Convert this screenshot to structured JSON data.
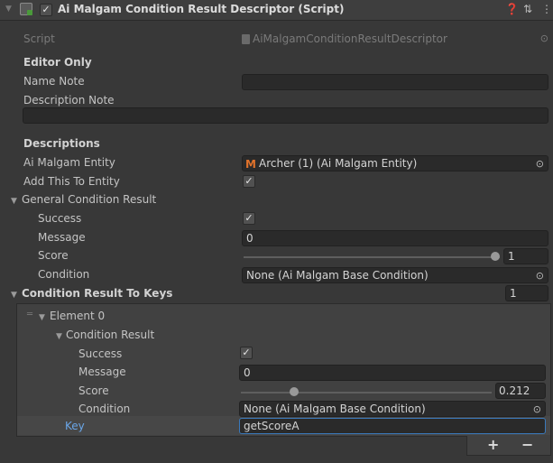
{
  "header": {
    "title": "Ai Malgam Condition Result Descriptor (Script)",
    "enabled_checked": true,
    "icons": [
      "fold-arrow-icon",
      "script-icon",
      "help-icon",
      "preset-icon",
      "kebab-menu-icon"
    ]
  },
  "script_row": {
    "label": "Script",
    "value": "AiMalgamConditionResultDescriptor"
  },
  "editor_only": {
    "heading": "Editor Only",
    "name_note_label": "Name Note",
    "name_note_value": "",
    "description_note_label": "Description Note",
    "description_note_value": ""
  },
  "descriptions": {
    "heading": "Descriptions",
    "entity_label": "Ai Malgam Entity",
    "entity_value": "Archer (1) (Ai Malgam Entity)",
    "add_to_entity_label": "Add This To Entity",
    "add_to_entity_checked": true
  },
  "general_condition_result": {
    "label": "General Condition Result",
    "success_label": "Success",
    "success_checked": true,
    "message_label": "Message",
    "message_value": "0",
    "score_label": "Score",
    "score_value": "1",
    "score_fraction": 1.0,
    "condition_label": "Condition",
    "condition_value": "None (Ai Malgam Base Condition)"
  },
  "condition_result_to_keys": {
    "label": "Condition Result To Keys",
    "size": "1",
    "elements": [
      {
        "label": "Element 0",
        "condition_result_label": "Condition Result",
        "success_label": "Success",
        "success_checked": true,
        "message_label": "Message",
        "message_value": "0",
        "score_label": "Score",
        "score_value": "0.212",
        "score_fraction": 0.212,
        "condition_label": "Condition",
        "condition_value": "None (Ai Malgam Base Condition)",
        "key_label": "Key",
        "key_value": "getScoreA"
      }
    ],
    "add_label": "+",
    "remove_label": "−"
  },
  "colors": {
    "background": "#383838",
    "field": "#2a2a2a",
    "accent_blue": "#3a79bb",
    "key_label_blue": "#6aa6e8",
    "entity_icon_orange": "#e0722b"
  }
}
